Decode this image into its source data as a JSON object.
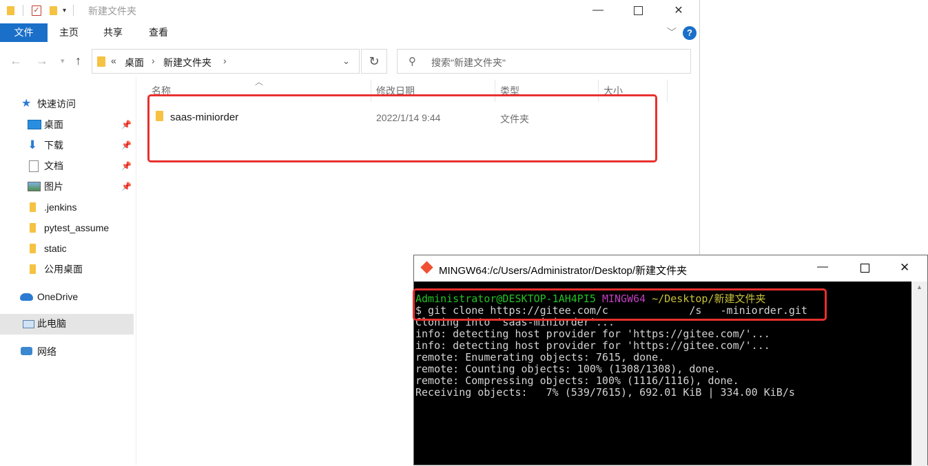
{
  "explorer": {
    "title": "新建文件夹",
    "ribbon_tabs": [
      "文件",
      "主页",
      "共享",
      "查看"
    ],
    "address": {
      "overflow": "«",
      "crumbs": [
        "桌面",
        "新建文件夹"
      ]
    },
    "search_placeholder": "搜索\"新建文件夹\"",
    "columns": [
      "名称",
      "修改日期",
      "类型",
      "大小"
    ],
    "rows": [
      {
        "name": "saas-miniorder",
        "date": "2022/1/14 9:44",
        "type": "文件夹"
      }
    ],
    "nav": {
      "quick_access": "快速访问",
      "pinned": [
        "桌面",
        "下载",
        "文档",
        "图片"
      ],
      "folders": [
        ".jenkins",
        "pytest_assume",
        "static",
        "公用桌面"
      ],
      "onedrive": "OneDrive",
      "this_pc": "此电脑",
      "network": "网络"
    },
    "accent_color": "#1a6fc9",
    "highlight_color": "#e8302e"
  },
  "terminal": {
    "title": "MINGW64:/c/Users/Administrator/Desktop/新建文件夹",
    "prompt_user": "Administrator@DESKTOP-1AH4PI5",
    "prompt_env": "MINGW64",
    "prompt_path": "~/Desktop/新建文件夹",
    "command": "$ git clone https://gitee.com/c             /s   -miniorder.git",
    "output": [
      "Cloning into 'saas-miniorder'...",
      "info: detecting host provider for 'https://gitee.com/'...",
      "info: detecting host provider for 'https://gitee.com/'...",
      "remote: Enumerating objects: 7615, done.",
      "remote: Counting objects: 100% (1308/1308), done.",
      "remote: Compressing objects: 100% (1116/1116), done.",
      "Receiving objects:   7% (539/7615), 692.01 KiB | 334.00 KiB/s"
    ]
  }
}
